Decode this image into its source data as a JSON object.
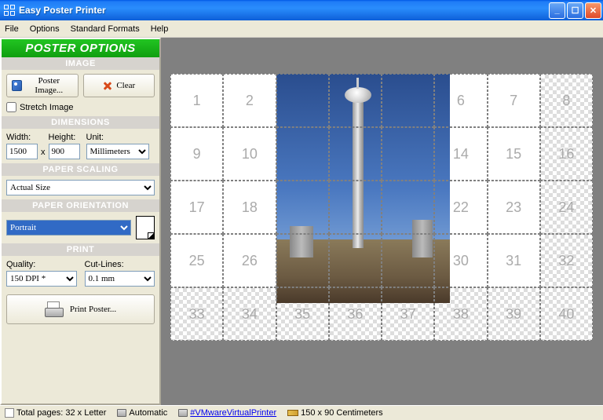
{
  "window": {
    "title": "Easy Poster Printer"
  },
  "menu": {
    "file": "File",
    "options": "Options",
    "standard_formats": "Standard Formats",
    "help": "Help"
  },
  "panel": {
    "title": "POSTER OPTIONS",
    "image": {
      "header": "IMAGE",
      "poster_image_btn": "Poster Image...",
      "clear_btn": "Clear",
      "stretch_label": "Stretch Image"
    },
    "dimensions": {
      "header": "DIMENSIONS",
      "width_label": "Width:",
      "width_value": "1500",
      "height_label": "Height:",
      "height_value": "900",
      "x": "x",
      "unit_label": "Unit:",
      "unit_value": "Millimeters"
    },
    "scaling": {
      "header": "PAPER SCALING",
      "value": "Actual Size"
    },
    "orientation": {
      "header": "PAPER ORIENTATION",
      "value": "Portrait"
    },
    "print": {
      "header": "PRINT",
      "quality_label": "Quality:",
      "quality_value": "150 DPI *",
      "cutlines_label": "Cut-Lines:",
      "cutlines_value": "0.1 mm",
      "print_poster_btn": "Print Poster..."
    }
  },
  "grid": {
    "cols": 8,
    "rows": 5,
    "plain_col": 7,
    "image_span": {
      "col_start": 2,
      "col_end": 5,
      "row_start": 0,
      "row_end": 4
    }
  },
  "status": {
    "pages": "Total pages: 32 x Letter",
    "mode": "Automatic",
    "printer": "#VMwareVirtualPrinter",
    "size": "150 x 90 Centimeters"
  }
}
